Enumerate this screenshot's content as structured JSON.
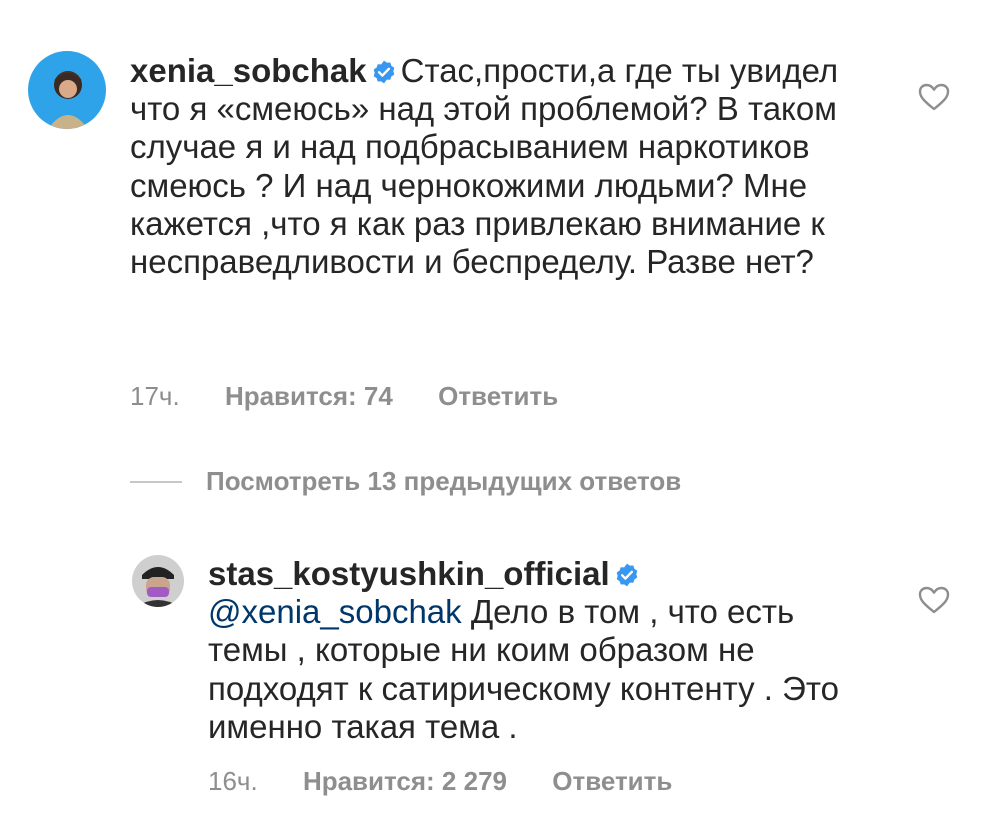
{
  "comments": [
    {
      "username": "xenia_sobchak",
      "verified": true,
      "mention": "",
      "text": "Стас,прости,а где ты увидел что я «смеюсь» над этой проблемой? В таком случае я и над подбрасыванием наркотиков смеюсь ? И над чернокожими людьми? Мне кажется ,что я как раз привлекаю внимание к несправедливости и беспределу. Разве нет?",
      "time": "17ч.",
      "likes_label": "Нравится: 74",
      "reply_label": "Ответить"
    },
    {
      "username": "stas_kostyushkin_official",
      "verified": true,
      "mention": "@xenia_sobchak",
      "text": "Дело в том , что есть темы , которые ни коим образом не подходят к сатирическому контенту . Это именно такая тема .",
      "time": "16ч.",
      "likes_label": "Нравится: 2 279",
      "reply_label": "Ответить"
    }
  ],
  "view_replies_label": "Посмотреть 13 предыдущих ответов",
  "colors": {
    "text": "#262626",
    "meta": "#8e8e8e",
    "mention": "#00376b",
    "verified": "#3897f0"
  },
  "icons": {
    "verified": "verified-badge-icon",
    "like": "heart-outline-icon"
  }
}
